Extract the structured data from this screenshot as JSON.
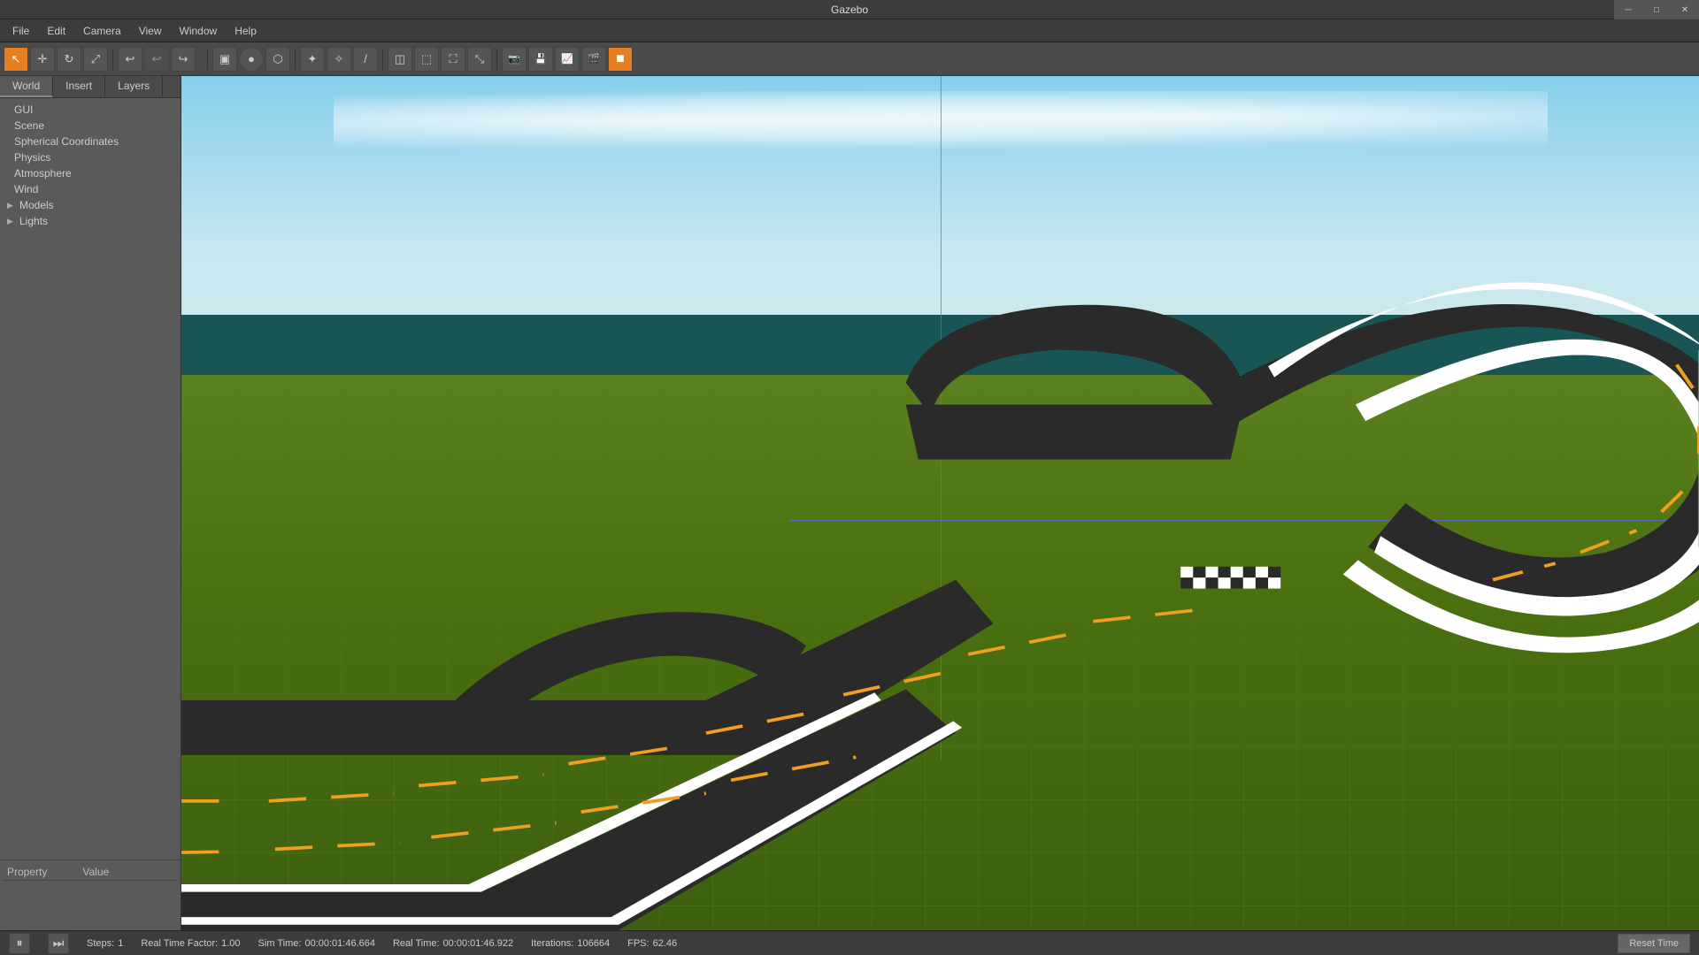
{
  "app": {
    "title": "Gazebo"
  },
  "titlebar": {
    "title": "Gazebo",
    "minimize_label": "─",
    "restore_label": "□",
    "close_label": "✕"
  },
  "menubar": {
    "items": [
      "File",
      "Edit",
      "Camera",
      "View",
      "Window",
      "Help"
    ]
  },
  "toolbar": {
    "tools": [
      {
        "name": "select",
        "icon": "↖",
        "active": true
      },
      {
        "name": "translate",
        "icon": "✛"
      },
      {
        "name": "rotate",
        "icon": "↻"
      },
      {
        "name": "scale",
        "icon": "⤢"
      },
      {
        "name": "undo",
        "icon": "↩"
      },
      {
        "name": "undo2",
        "icon": "↩"
      },
      {
        "name": "redo",
        "icon": "↪"
      },
      {
        "name": "sep1"
      },
      {
        "name": "box",
        "icon": "▣"
      },
      {
        "name": "sphere",
        "icon": "●"
      },
      {
        "name": "cylinder",
        "icon": "⬡"
      },
      {
        "name": "light1",
        "icon": "✦"
      },
      {
        "name": "light2",
        "icon": "✧"
      },
      {
        "name": "sep2"
      },
      {
        "name": "tool1",
        "icon": "/"
      },
      {
        "name": "tool2",
        "icon": "◫"
      },
      {
        "name": "tool3",
        "icon": "⬚"
      },
      {
        "name": "tool4",
        "icon": "⛶"
      },
      {
        "name": "tool5",
        "icon": "⤡"
      },
      {
        "name": "sep3"
      },
      {
        "name": "screenshot",
        "icon": "📷"
      },
      {
        "name": "save",
        "icon": "💾"
      },
      {
        "name": "graph",
        "icon": "📈"
      },
      {
        "name": "video",
        "icon": "🎬"
      },
      {
        "name": "color-active",
        "icon": "■",
        "active": true
      }
    ]
  },
  "sidebar": {
    "tabs": [
      "World",
      "Insert",
      "Layers"
    ],
    "active_tab": "World",
    "tree": [
      {
        "label": "GUI",
        "indent": 1
      },
      {
        "label": "Scene",
        "indent": 1
      },
      {
        "label": "Spherical Coordinates",
        "indent": 1
      },
      {
        "label": "Physics",
        "indent": 1
      },
      {
        "label": "Atmosphere",
        "indent": 1
      },
      {
        "label": "Wind",
        "indent": 1
      },
      {
        "label": "Models",
        "indent": 1,
        "expandable": true
      },
      {
        "label": "Lights",
        "indent": 1,
        "expandable": true
      }
    ],
    "properties": {
      "col1": "Property",
      "col2": "Value"
    }
  },
  "statusbar": {
    "pause_icon": "⏸",
    "skip_icon": "⏭",
    "steps_label": "Steps:",
    "steps_value": "1",
    "rtf_label": "Real Time Factor:",
    "rtf_value": "1.00",
    "sim_time_label": "Sim Time:",
    "sim_time_value": "00:00:01:46.664",
    "real_time_label": "Real Time:",
    "real_time_value": "00:00:01:46.922",
    "iterations_label": "Iterations:",
    "iterations_value": "106664",
    "fps_label": "FPS:",
    "fps_value": "62.46",
    "reset_time_label": "Reset Time"
  }
}
